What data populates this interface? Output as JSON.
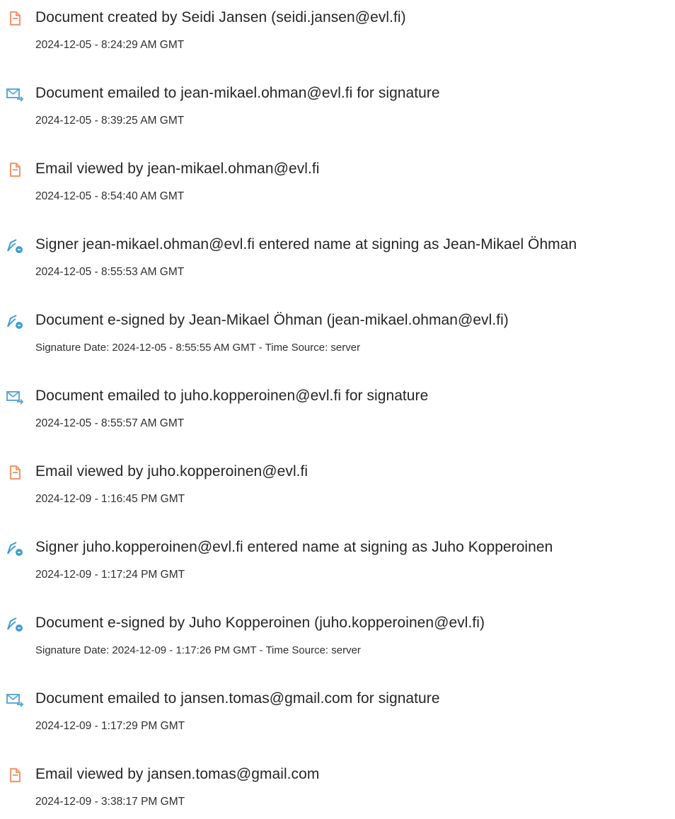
{
  "entries": [
    {
      "icon": "document-created-icon",
      "title": "Document created by Seidi Jansen (seidi.jansen@evl.fi)",
      "sub": "2024-12-05 - 8:24:29 AM GMT"
    },
    {
      "icon": "email-sent-icon",
      "title": "Document emailed to jean-mikael.ohman@evl.fi for signature",
      "sub": "2024-12-05 - 8:39:25 AM GMT"
    },
    {
      "icon": "document-viewed-icon",
      "title": "Email viewed by jean-mikael.ohman@evl.fi",
      "sub": "2024-12-05 - 8:54:40 AM GMT"
    },
    {
      "icon": "signature-icon",
      "title": "Signer jean-mikael.ohman@evl.fi entered name at signing as Jean-Mikael Öhman",
      "sub": "2024-12-05 - 8:55:53 AM GMT"
    },
    {
      "icon": "signature-icon",
      "title": "Document e-signed by Jean-Mikael Öhman (jean-mikael.ohman@evl.fi)",
      "sub": "Signature Date: 2024-12-05 - 8:55:55 AM GMT - Time Source: server"
    },
    {
      "icon": "email-sent-icon",
      "title": "Document emailed to juho.kopperoinen@evl.fi for signature",
      "sub": "2024-12-05 - 8:55:57 AM GMT"
    },
    {
      "icon": "document-viewed-icon",
      "title": "Email viewed by juho.kopperoinen@evl.fi",
      "sub": "2024-12-09 - 1:16:45 PM GMT"
    },
    {
      "icon": "signature-icon",
      "title": "Signer juho.kopperoinen@evl.fi entered name at signing as Juho Kopperoinen",
      "sub": "2024-12-09 - 1:17:24 PM GMT"
    },
    {
      "icon": "signature-icon",
      "title": "Document e-signed by Juho Kopperoinen (juho.kopperoinen@evl.fi)",
      "sub": "Signature Date: 2024-12-09 - 1:17:26 PM GMT - Time Source: server"
    },
    {
      "icon": "email-sent-icon",
      "title": "Document emailed to jansen.tomas@gmail.com for signature",
      "sub": "2024-12-09 - 1:17:29 PM GMT"
    },
    {
      "icon": "document-viewed-icon",
      "title": "Email viewed by jansen.tomas@gmail.com",
      "sub": "2024-12-09 - 3:38:17 PM GMT"
    }
  ],
  "colors": {
    "document_icon": "#f29b73",
    "email_icon": "#5fa9d6",
    "signature_icon": "#3f9fd0",
    "text": "#262626"
  }
}
